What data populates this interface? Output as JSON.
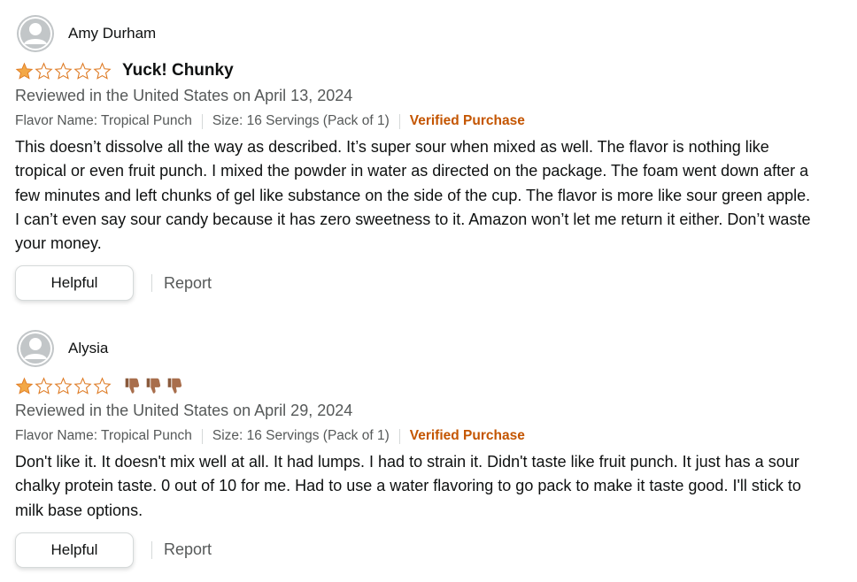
{
  "colors": {
    "accent": "#c45500",
    "star": "#f3a847",
    "text": "#0f1111",
    "muted": "#565959"
  },
  "reviews": [
    {
      "profile_name": "Amy Durham",
      "avatar_icon": "default-avatar-icon",
      "rating": 1,
      "rating_max": 5,
      "title": "Yuck! Chunky",
      "date": "Reviewed in the United States on April 13, 2024",
      "flavor": "Flavor Name: Tropical Punch",
      "size": "Size: 16 Servings (Pack of 1)",
      "verified": "Verified Purchase",
      "body": "This doesn’t dissolve all the way as described. It’s super sour when mixed as well. The flavor is nothing like tropical or even fruit punch. I mixed the powder in water as directed on the package. The foam went down after a few minutes and left chunks of gel like substance on the side of the cup. The flavor is more like sour green apple. I can’t even say sour candy because it has zero sweetness to it. Amazon won’t let me return it either. Don’t waste your money.",
      "helpful_label": "Helpful",
      "report_label": "Report"
    },
    {
      "profile_name": "Alysia",
      "avatar_icon": "default-avatar-icon",
      "rating": 1,
      "rating_max": 5,
      "title_icons": [
        "thumbs-down-icon",
        "thumbs-down-icon",
        "thumbs-down-icon"
      ],
      "date": "Reviewed in the United States on April 29, 2024",
      "flavor": "Flavor Name: Tropical Punch",
      "size": "Size: 16 Servings (Pack of 1)",
      "verified": "Verified Purchase",
      "body": "Don't like it. It doesn't mix well at all. It had lumps. I had to strain it. Didn't taste like fruit punch. It just has a sour chalky protein taste. 0 out of 10 for me. Had to use a water flavoring to go pack to make it taste good. I'll stick to milk base options.",
      "helpful_label": "Helpful",
      "report_label": "Report"
    }
  ]
}
